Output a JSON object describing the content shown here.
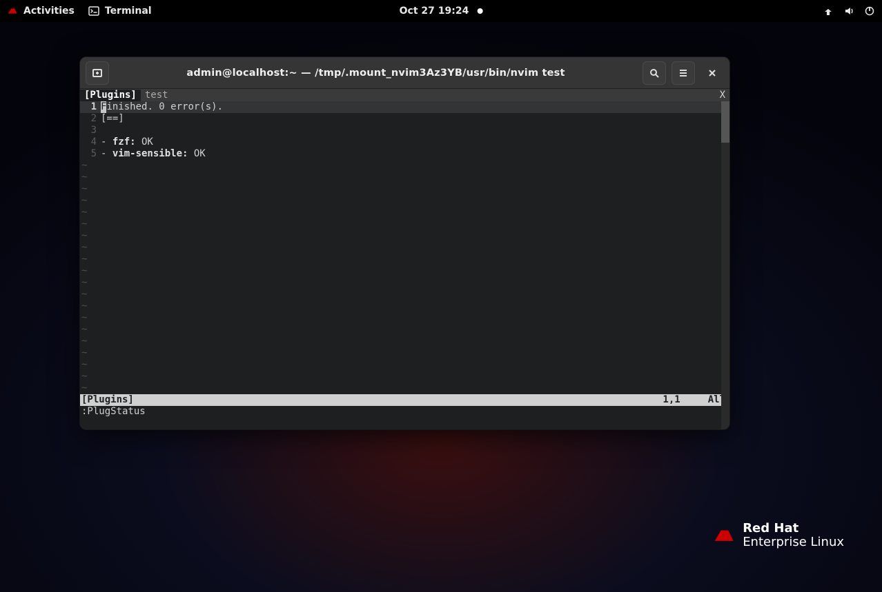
{
  "topbar": {
    "activities": "Activities",
    "app_name": "Terminal",
    "clock": "Oct 27  19:24"
  },
  "window": {
    "title": "admin@localhost:~ — /tmp/.mount_nvim3Az3YB/usr/bin/nvim test"
  },
  "nvim": {
    "tabs": {
      "active": "[Plugins]",
      "inactive": "test",
      "closeX": "X"
    },
    "lines": [
      {
        "n": "1",
        "text_before_cursor": "",
        "cursor": "F",
        "text_after_cursor": "inished. 0 error(s).",
        "current": true
      },
      {
        "n": "2",
        "raw": "[==]"
      },
      {
        "n": "3",
        "raw": ""
      },
      {
        "n": "4",
        "prefix": "- ",
        "kw": "fzf:",
        "rest": " OK"
      },
      {
        "n": "5",
        "prefix": "- ",
        "kw": "vim-sensible:",
        "rest": " OK"
      }
    ],
    "tilde_rows": 20,
    "status": {
      "left": "[Plugins]",
      "pos": "1,1",
      "pct": "All"
    },
    "cmdline": ":PlugStatus"
  },
  "watermark": {
    "l1": "Red Hat",
    "l2": "Enterprise Linux"
  }
}
